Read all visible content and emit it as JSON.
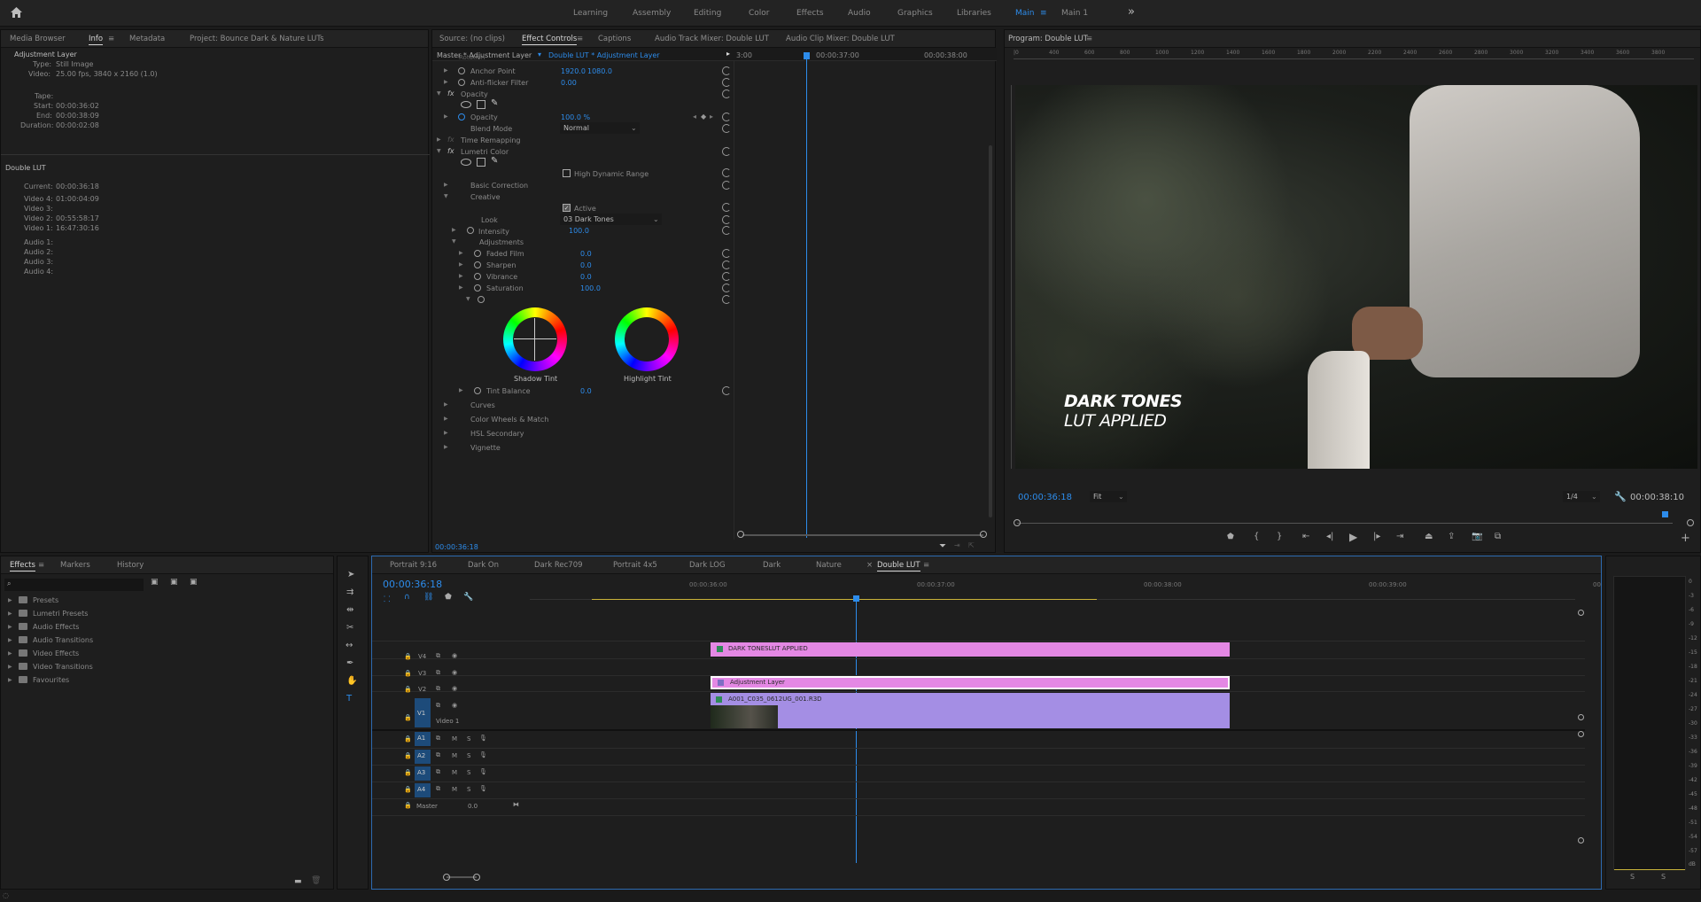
{
  "workspaces": {
    "items": [
      "Learning",
      "Assembly",
      "Editing",
      "Color",
      "Effects",
      "Audio",
      "Graphics",
      "Libraries",
      "Main",
      "Main 1"
    ],
    "active": "Main",
    "more": "»"
  },
  "info_panel": {
    "tabs": [
      "Media Browser",
      "Info",
      "Metadata",
      "Project: Bounce Dark & Nature LUTs"
    ],
    "clip_name": "Adjustment Layer",
    "type_label": "Type:",
    "type": "Still Image",
    "video_label": "Video:",
    "video": "25.00 fps, 3840 x 2160 (1.0)",
    "tape_label": "Tape:",
    "start_label": "Start:",
    "start": "00:00:36:02",
    "end_label": "End:",
    "end": "00:00:38:09",
    "duration_label": "Duration:",
    "duration": "00:00:02:08",
    "sequence": "Double LUT",
    "current_label": "Current:",
    "current": "00:00:36:18",
    "v4_label": "Video 4:",
    "v4": "01:00:04:09",
    "v3_label": "Video 3:",
    "v2_label": "Video 2:",
    "v2": "00:55:58:17",
    "v1_label": "Video 1:",
    "v1": "16:47:30:16",
    "a1": "Audio 1:",
    "a2": "Audio 2:",
    "a3": "Audio 3:",
    "a4": "Audio 4:"
  },
  "effect_controls": {
    "tabs": [
      "Source: (no clips)",
      "Effect Controls",
      "Captions",
      "Audio Track Mixer: Double LUT",
      "Audio Clip Mixer: Double LUT"
    ],
    "master": "Master * Adjustment Layer",
    "clip": "Double LUT * Adjustment Layer",
    "tl_start": "3:00",
    "tl_mid": "00:00:37:00",
    "tl_end": "00:00:38:00",
    "rotation": "Rotation",
    "anchor": "Anchor Point",
    "anchor_x": "1920.0",
    "anchor_y": "1080.0",
    "antiflicker": "Anti-flicker Filter",
    "antiflicker_v": "0.00",
    "fx": "fx",
    "opacity_group": "Opacity",
    "opacity": "Opacity",
    "opacity_v": "100.0 %",
    "blend": "Blend Mode",
    "blend_v": "Normal",
    "time_remap": "Time Remapping",
    "lumetri": "Lumetri Color",
    "hdr": "High Dynamic Range",
    "basic": "Basic Correction",
    "creative": "Creative",
    "active": "Active",
    "look": "Look",
    "look_v": "03 Dark Tones",
    "intensity": "Intensity",
    "intensity_v": "100.0",
    "adjustments": "Adjustments",
    "faded": "Faded Film",
    "faded_v": "0.0",
    "sharpen": "Sharpen",
    "sharpen_v": "0.0",
    "vibrance": "Vibrance",
    "vibrance_v": "0.0",
    "saturation": "Saturation",
    "saturation_v": "100.0",
    "shadow_tint": "Shadow Tint",
    "highlight_tint": "Highlight Tint",
    "tint_balance": "Tint Balance",
    "tint_balance_v": "0.0",
    "curves": "Curves",
    "wheels": "Color Wheels & Match",
    "hsl": "HSL Secondary",
    "vignette": "Vignette",
    "footer_tc": "00:00:36:18"
  },
  "program": {
    "title": "Program: Double LUT",
    "overlay1": "DARK TONES",
    "overlay2": "LUT APPLIED",
    "tc": "00:00:36:18",
    "fit": "Fit",
    "res": "1/4",
    "duration": "00:00:38:10",
    "ruler": [
      "|0",
      "400",
      "600",
      "800",
      "1000",
      "1200",
      "1400",
      "1600",
      "1800",
      "2000",
      "2200",
      "2400",
      "2600",
      "2800",
      "3000",
      "3200",
      "3400",
      "3600",
      "3800"
    ]
  },
  "effects_panel": {
    "tabs": [
      "Effects",
      "Markers",
      "History"
    ],
    "items": [
      "Presets",
      "Lumetri Presets",
      "Audio Effects",
      "Audio Transitions",
      "Video Effects",
      "Video Transitions",
      "Favourites"
    ]
  },
  "timeline": {
    "tabs": [
      "Portrait 9:16",
      "Dark On",
      "Dark Rec709",
      "Portrait 4x5",
      "Dark LOG",
      "Dark",
      "Nature",
      "Double LUT"
    ],
    "tc": "00:00:36:18",
    "ruler": [
      "00:00:36:00",
      "00:00:37:00",
      "00:00:38:00",
      "00:00:39:00",
      "00"
    ],
    "video_tracks": [
      "V4",
      "V3",
      "V2",
      "V1"
    ],
    "v1_name": "Video 1",
    "audio_tracks": [
      "A1",
      "A2",
      "A3",
      "A4"
    ],
    "master": "Master",
    "master_v": "0.0",
    "clips": {
      "title": "DARK TONESLUT APPLIED",
      "adj": "Adjustment Layer",
      "video": "A001_C035_0612UG_001.R3D"
    }
  },
  "meter": {
    "scale": [
      "0",
      "-3",
      "-6",
      "-9",
      "-12",
      "-15",
      "-18",
      "-21",
      "-24",
      "-27",
      "-30",
      "-33",
      "-36",
      "-39",
      "-42",
      "-45",
      "-48",
      "-51",
      "-54",
      "-57",
      "dB"
    ],
    "solo": [
      "S",
      "S"
    ]
  },
  "colors": {
    "accent": "#2d8ceb",
    "pink": "#e488e4",
    "lavender": "#a48ee4",
    "bg": "#1e1e1e"
  }
}
